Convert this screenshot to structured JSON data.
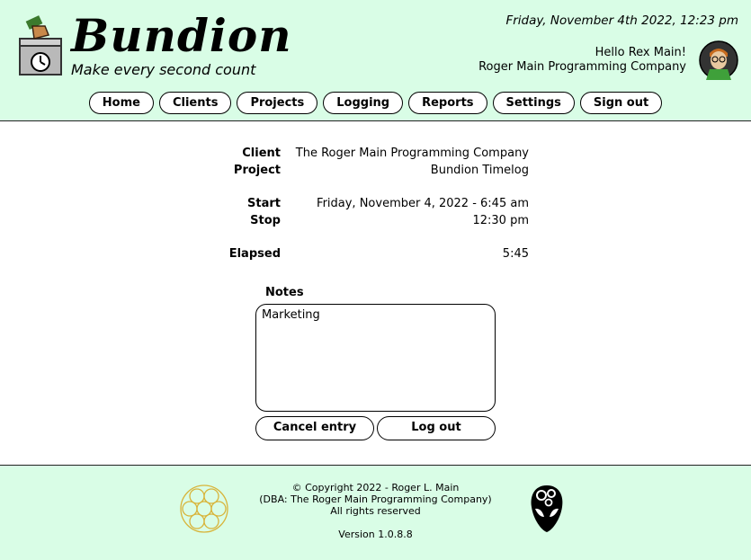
{
  "header": {
    "brand": "Bundion",
    "tagline": "Make every second count",
    "datetime": "Friday, November 4th 2022, 12:23 pm",
    "greeting": "Hello Rex Main!",
    "company": "Roger Main Programming Company"
  },
  "nav": [
    "Home",
    "Clients",
    "Projects",
    "Logging",
    "Reports",
    "Settings",
    "Sign out"
  ],
  "entry": {
    "client_label": "Client",
    "client_value": "The Roger Main Programming Company",
    "project_label": "Project",
    "project_value": "Bundion Timelog",
    "start_label": "Start",
    "start_value": "Friday, November 4, 2022 - 6:45 am",
    "stop_label": "Stop",
    "stop_value": "12:30 pm",
    "elapsed_label": "Elapsed",
    "elapsed_value": "5:45",
    "notes_label": "Notes",
    "notes_value": "Marketing",
    "cancel_label": "Cancel entry",
    "logout_label": "Log out"
  },
  "footer": {
    "copyright": "© Copyright 2022 - Roger L. Main",
    "dba": "(DBA: The Roger Main Programming Company)",
    "rights": "All rights reserved",
    "version": "Version 1.0.8.8"
  },
  "icons": {
    "logo": "time-clock-ballot-icon",
    "avatar": "user-avatar",
    "left_footer": "circles-logo-icon",
    "right_footer": "alien-gears-icon"
  },
  "colors": {
    "header_bg": "#d9fde6",
    "gold": "#d8b43a"
  }
}
